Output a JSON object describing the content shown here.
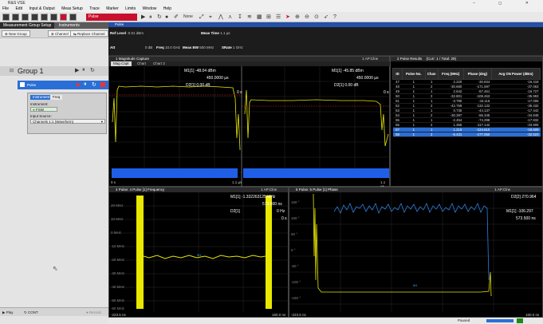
{
  "app": {
    "title": "R&S VSE",
    "window_controls": "–  ◻  ✕"
  },
  "menu": [
    "File",
    "Edit",
    "Input & Output",
    "Meas Setup",
    "Trace",
    "Marker",
    "Limits",
    "Window",
    "Help"
  ],
  "toolbar": {
    "mode_label": "Pulse",
    "zoom_label": "None"
  },
  "left_panel": {
    "tabs": [
      "Measurement Group Setup",
      "Instruments"
    ],
    "new_group_label": "New Group",
    "channel_label": "Channel",
    "replace_channel_label": "Replace Channel",
    "group_title": "Group 1",
    "channel_item_label": "Pulse",
    "subtabs": [
      "Instrument",
      "Freq"
    ],
    "instrument_label": "Instrument:",
    "instrument_value": "FSW",
    "input_source_label": "Input Source:",
    "input_source_value": "Channels 1:1 (Waveform)",
    "play_label": "Play",
    "cont_label": "CONT",
    "record_label": "Record"
  },
  "info_bar": {
    "channel_tab": "Pulse",
    "ref_level_label": "Ref Level",
    "ref_level_value": "-0.01 dBm",
    "att_label": "Att",
    "att_value": "0 dB",
    "meas_time_label": "Meas Time",
    "meas_time_value": "1.1 µs",
    "freq_label": "Freq",
    "freq_value": "10.0 GHz",
    "meas_bw_label": "Meas BW",
    "meas_bw_value": "500 MHz",
    "srate_label": "SRate",
    "srate_value": "1 GHz"
  },
  "window1": {
    "title": "1 Magnitude Capture",
    "badge": "1 AP:Clrw",
    "tabs": [
      "Mag Capt",
      "Chart",
      "Chart 3"
    ],
    "m1_label": "M1[1]",
    "m1_value": "-48.04 dBm",
    "m1_time": "450.0000 µs",
    "d2_label": "D2[1]",
    "d2_value": "0.00 dB",
    "d2_time": "0 s",
    "x_start": "0 s",
    "x_end": "1.1 µs"
  },
  "window1b": {
    "m1_label": "M1[1]",
    "m1_value": "-45.85 dBm",
    "m1_time": "450.0000 µs",
    "d2_label": "D2[1]",
    "d2_value": "0.00 dB",
    "d2_time": "0 s",
    "x_end": "1.1 µs"
  },
  "window2": {
    "title": "2 Pulse Results",
    "subtitle": "(Curr: 1 / Total: 29)",
    "headers": [
      "ID",
      "Pulse No.",
      "Chan",
      "Freq (MHz)",
      "Phase (deg)",
      "Avg ON Power (dBm)"
    ],
    "rows": [
      [
        "47",
        "1",
        "1",
        "2.220",
        "-30.834",
        "-16.418"
      ],
      [
        "48",
        "1",
        "2",
        "-30.680",
        "-171.597",
        "-37.063"
      ],
      [
        "49",
        "1",
        "1",
        "2.642",
        "-57.461",
        "-16.727"
      ],
      [
        "50",
        "1",
        "2",
        "-32.801",
        "-108.463",
        "-35.993"
      ],
      [
        "51",
        "1",
        "1",
        "-3.790",
        "-44.116",
        "-17.006"
      ],
      [
        "52",
        "1",
        "2",
        "-42.759",
        "-132.132",
        "-35.432"
      ],
      [
        "53",
        "1",
        "1",
        "0.735",
        "-44.137",
        "-17.442"
      ],
      [
        "54",
        "1",
        "2",
        "-30.397",
        "-56.345",
        "-34.848"
      ],
      [
        "55",
        "1",
        "1",
        "-2.454",
        "-74.298",
        "-17.832"
      ],
      [
        "56",
        "1",
        "2",
        "1.355",
        "-117.142",
        "-33.905"
      ],
      [
        "57",
        "1",
        "1",
        "1.210",
        "-124.610",
        "-18.609"
      ],
      [
        "58",
        "1",
        "2",
        "-6.431",
        "-177.050",
        "-32.523"
      ]
    ]
  },
  "window4": {
    "title": "4 Pulse: 4 Pulse [1] Frequency",
    "badge": "1 AP:Clrw",
    "m1_label": "M1[1]",
    "m1_value": "-1.332263125 MHz",
    "m1_time": "573.500 ns",
    "d2_label": "D2[1]",
    "d2_value": "0 Hz",
    "d2_time": "0 s",
    "y_ticks": [
      "20 MHz",
      "10 MHz",
      "0 MHz",
      "-10 MHz",
      "-20 MHz",
      "-30 MHz",
      "-40 MHz",
      "-50 MHz",
      "-60 MHz"
    ],
    "x_start": "-223.5 ns",
    "x_end": "160.0 ns"
  },
  "window5": {
    "title": "5 Pulse: 5 Pulse [1] Phase",
    "badge": "1 AP:Clrw",
    "d2_label": "D2[2]",
    "d2_value": "270.964",
    "m1_label": "M1[1]",
    "m1_value": "-106.297",
    "m1_time": "573.500 ns",
    "y_ticks": [
      "150 °",
      "100 °",
      "50 °",
      "0 °",
      "-50 °",
      "-100 °",
      "-150 °"
    ],
    "x_start": "-223.5 ns",
    "x_end": "160.0 ns"
  },
  "status": {
    "state": "Paused"
  },
  "colors": {
    "accent": "#2a6fd6",
    "trace": "#e8e800",
    "phase_trace": "#2f7fe0",
    "mode_red": "#c8102e"
  }
}
